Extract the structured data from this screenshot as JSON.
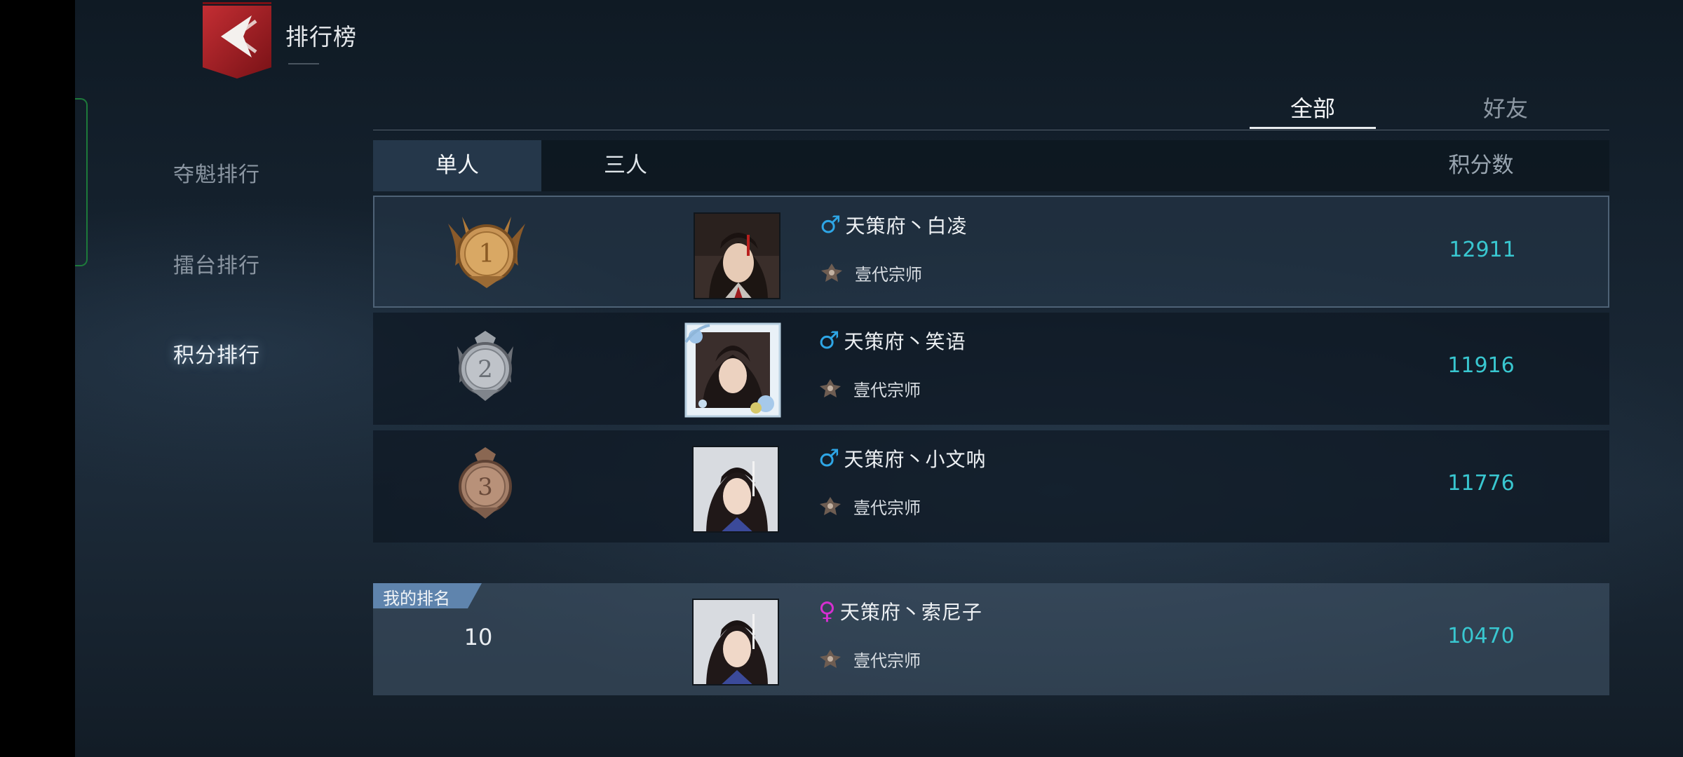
{
  "header": {
    "title": "排行榜"
  },
  "sidebar": {
    "items": [
      {
        "label": "夺魁排行"
      },
      {
        "label": "擂台排行"
      },
      {
        "label": "积分排行"
      }
    ],
    "active_index": 2
  },
  "scope_tabs": [
    {
      "label": "全部"
    },
    {
      "label": "好友"
    }
  ],
  "mode_tabs": [
    {
      "label": "单人"
    },
    {
      "label": "三人"
    }
  ],
  "columns": {
    "score": "积分数"
  },
  "rows": [
    {
      "rank": 1,
      "gender": "male",
      "gender_symbol": "♂",
      "name": "天策府丶白凌",
      "title": "壹代宗师",
      "score": "12911"
    },
    {
      "rank": 2,
      "gender": "male",
      "gender_symbol": "♂",
      "name": "天策府丶笑语",
      "title": "壹代宗师",
      "score": "11916"
    },
    {
      "rank": 3,
      "gender": "male",
      "gender_symbol": "♂",
      "name": "天策府丶小文呐",
      "title": "壹代宗师",
      "score": "11776"
    }
  ],
  "my_rank": {
    "badge": "我的排名",
    "rank": "10",
    "gender": "female",
    "gender_symbol": "♀",
    "name": "天策府丶索尼子",
    "title": "壹代宗师",
    "score": "10470"
  },
  "colors": {
    "accent_score": "#39c7d0",
    "male": "#2ea6e6",
    "female": "#d52fd0",
    "back_button": "#b3242a"
  },
  "medal_labels": [
    "1",
    "2",
    "3"
  ]
}
